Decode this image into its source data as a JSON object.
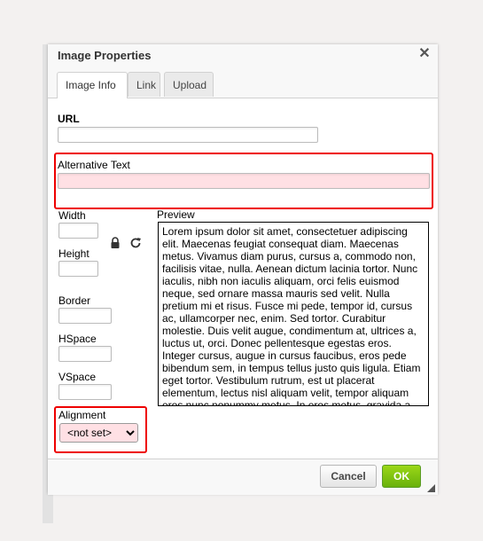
{
  "dialog": {
    "title": "Image Properties",
    "close_glyph": "✕",
    "tabs": [
      {
        "label": "Image Info",
        "active": true
      },
      {
        "label": "Link",
        "active": false
      },
      {
        "label": "Upload",
        "active": false
      }
    ]
  },
  "fields": {
    "url": {
      "label": "URL",
      "value": ""
    },
    "alt": {
      "label": "Alternative Text",
      "value": ""
    },
    "width": {
      "label": "Width",
      "value": ""
    },
    "height": {
      "label": "Height",
      "value": ""
    },
    "border": {
      "label": "Border",
      "value": ""
    },
    "hspace": {
      "label": "HSpace",
      "value": ""
    },
    "vspace": {
      "label": "VSpace",
      "value": ""
    },
    "alignment": {
      "label": "Alignment",
      "selected": "<not set>"
    }
  },
  "preview": {
    "label": "Preview",
    "text": "Lorem ipsum dolor sit amet, consectetuer adipiscing elit. Maecenas feugiat consequat diam. Maecenas metus. Vivamus diam purus, cursus a, commodo non, facilisis vitae, nulla. Aenean dictum lacinia tortor. Nunc iaculis, nibh non iaculis aliquam, orci felis euismod neque, sed ornare massa mauris sed velit. Nulla pretium mi et risus. Fusce mi pede, tempor id, cursus ac, ullamcorper nec, enim. Sed tortor. Curabitur molestie. Duis velit augue, condimentum at, ultrices a, luctus ut, orci. Donec pellentesque egestas eros. Integer cursus, augue in cursus faucibus, eros pede bibendum sem, in tempus tellus justo quis ligula. Etiam eget tortor. Vestibulum rutrum, est ut placerat elementum, lectus nisl aliquam velit, tempor aliquam eros nunc nonummy metus. In eros metus, gravida a, gravida sed, lobortis id, turpis. Ut"
  },
  "icons": {
    "lock": "lock-icon",
    "reset": "reset-size-icon"
  },
  "buttons": {
    "cancel": "Cancel",
    "ok": "OK"
  },
  "colors": {
    "highlight": "#ee0000",
    "ok_green": "#69b10b"
  }
}
